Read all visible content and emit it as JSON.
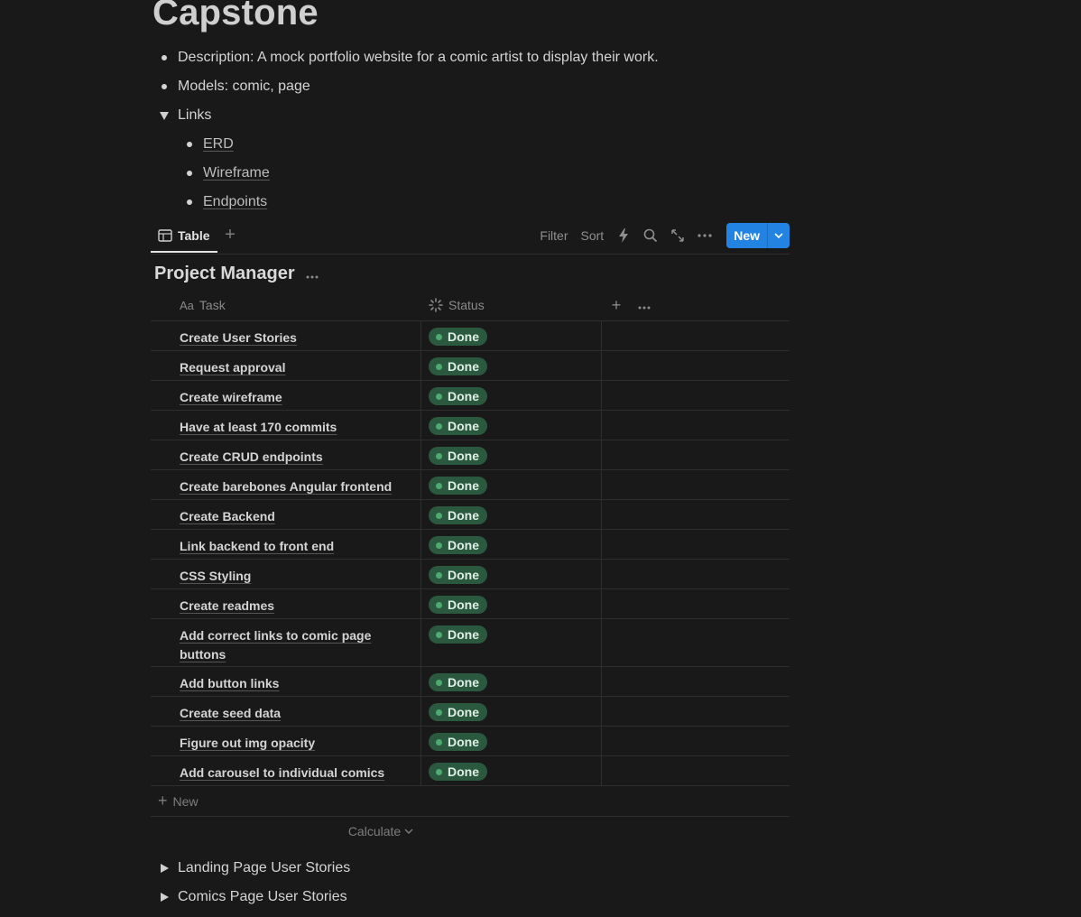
{
  "page": {
    "title": "Capstone",
    "description": "Description: A mock portfolio website for a comic artist to display their work.",
    "models": "Models: comic, page",
    "links_toggle": "Links",
    "links": [
      "ERD",
      "Wireframe",
      "Endpoints"
    ]
  },
  "view": {
    "tab_label": "Table",
    "filter": "Filter",
    "sort": "Sort",
    "new_button": "New",
    "accent": "#2383e2"
  },
  "database": {
    "title": "Project Manager",
    "columns": {
      "task": "Task",
      "task_icon": "Aa",
      "status": "Status"
    },
    "rows": [
      {
        "task": "Create User Stories",
        "status": "Done"
      },
      {
        "task": "Request approval",
        "status": "Done"
      },
      {
        "task": "Create wireframe",
        "status": "Done"
      },
      {
        "task": "Have at least 170 commits",
        "status": "Done"
      },
      {
        "task": "Create CRUD endpoints",
        "status": "Done"
      },
      {
        "task": "Create barebones Angular frontend",
        "status": "Done"
      },
      {
        "task": "Create Backend",
        "status": "Done"
      },
      {
        "task": "Link backend to front end",
        "status": "Done"
      },
      {
        "task": "CSS Styling",
        "status": "Done"
      },
      {
        "task": "Create readmes",
        "status": "Done"
      },
      {
        "task": "Add correct links to comic page buttons",
        "status": "Done"
      },
      {
        "task": "Add button links",
        "status": "Done"
      },
      {
        "task": "Create seed data",
        "status": "Done"
      },
      {
        "task": "Figure out img opacity",
        "status": "Done"
      },
      {
        "task": "Add carousel to individual comics",
        "status": "Done"
      }
    ],
    "new_row": "New",
    "calculate": "Calculate",
    "status_color": "#2b593f",
    "status_dot_color": "#4dab6f"
  },
  "toggles": [
    "Landing Page User Stories",
    "Comics Page User Stories"
  ]
}
